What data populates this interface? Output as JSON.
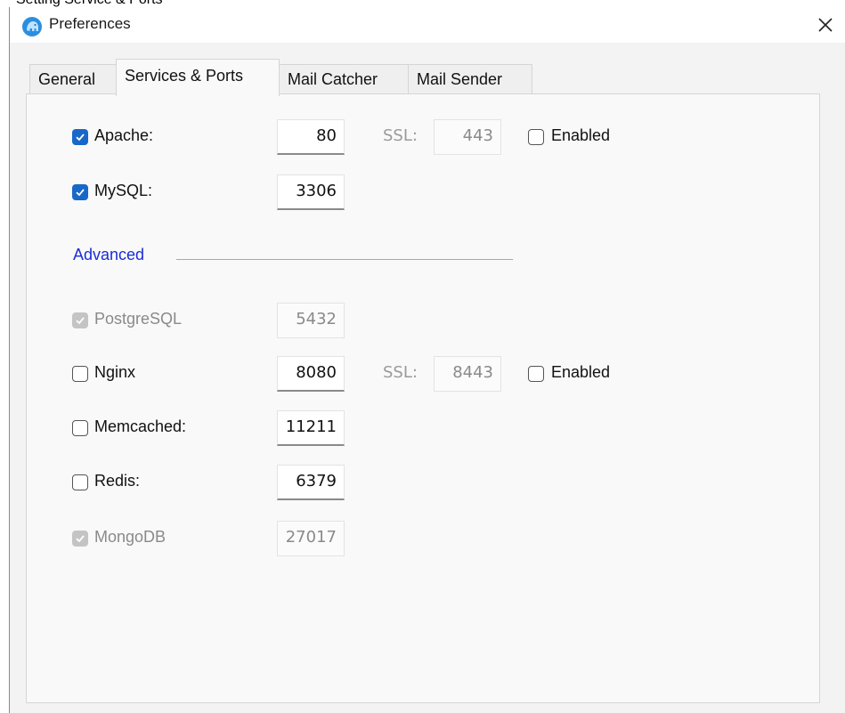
{
  "caption": "Setting Service & Ports",
  "window": {
    "title": "Preferences",
    "close_icon": "close-icon"
  },
  "tabs": [
    {
      "label": "General",
      "active": false
    },
    {
      "label": "Services & Ports",
      "active": true
    },
    {
      "label": "Mail Catcher",
      "active": false
    },
    {
      "label": "Mail Sender",
      "active": false
    }
  ],
  "ssl_label": "SSL:",
  "enabled_label": "Enabled",
  "advanced_label": "Advanced",
  "services": {
    "apache": {
      "label": "Apache:",
      "checked": true,
      "port": "80",
      "ssl_port": "443",
      "ssl_enabled": false
    },
    "mysql": {
      "label": "MySQL:",
      "checked": true,
      "port": "3306"
    },
    "postgresql": {
      "label": "PostgreSQL",
      "checked": true,
      "disabled": true,
      "port": "5432"
    },
    "nginx": {
      "label": "Nginx",
      "checked": false,
      "port": "8080",
      "ssl_port": "8443",
      "ssl_enabled": false
    },
    "memcached": {
      "label": "Memcached:",
      "checked": false,
      "port": "11211"
    },
    "redis": {
      "label": "Redis:",
      "checked": false,
      "port": "6379"
    },
    "mongodb": {
      "label": "MongoDB",
      "checked": true,
      "disabled": true,
      "port": "27017"
    }
  },
  "colors": {
    "accent": "#1868c9",
    "advanced_text": "#1a2cd8",
    "disabled_check": "#c4c4c4"
  }
}
